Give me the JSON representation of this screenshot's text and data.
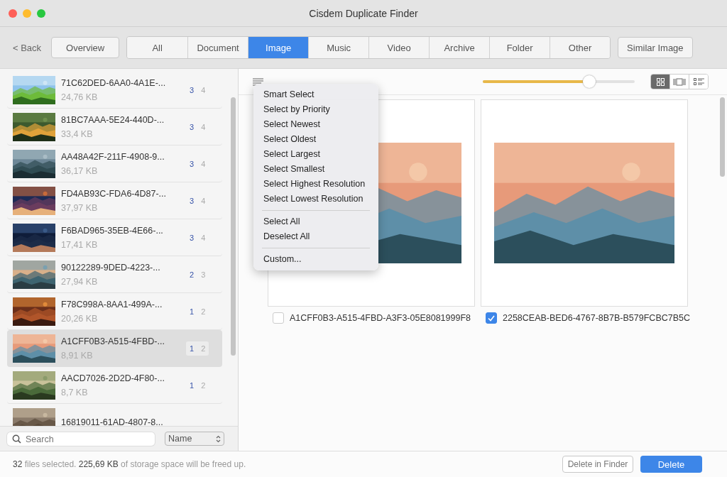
{
  "window": {
    "title": "Cisdem Duplicate Finder"
  },
  "toolbar": {
    "back": "< Back",
    "overview": "Overview",
    "similar": "Similar Image",
    "tabs": [
      {
        "label": "All",
        "selected": false
      },
      {
        "label": "Document",
        "selected": false
      },
      {
        "label": "Image",
        "selected": true
      },
      {
        "label": "Music",
        "selected": false
      },
      {
        "label": "Video",
        "selected": false
      },
      {
        "label": "Archive",
        "selected": false
      },
      {
        "label": "Folder",
        "selected": false
      },
      {
        "label": "Other",
        "selected": false
      }
    ]
  },
  "sidebar": {
    "items": [
      {
        "name": "71C62DED-6AA0-4A1E-...",
        "size": "24,76 KB",
        "selected_count": "3",
        "total_count": "4",
        "selected": false
      },
      {
        "name": "81BC7AAA-5E24-440D-...",
        "size": "33,4 KB",
        "selected_count": "3",
        "total_count": "4",
        "selected": false
      },
      {
        "name": "AA48A42F-211F-4908-9...",
        "size": "36,17 KB",
        "selected_count": "3",
        "total_count": "4",
        "selected": false
      },
      {
        "name": "FD4AB93C-FDA6-4D87-...",
        "size": "37,97 KB",
        "selected_count": "3",
        "total_count": "4",
        "selected": false
      },
      {
        "name": "F6BAD965-35EB-4E66-...",
        "size": "17,41 KB",
        "selected_count": "3",
        "total_count": "4",
        "selected": false
      },
      {
        "name": "90122289-9DED-4223-...",
        "size": "27,94 KB",
        "selected_count": "2",
        "total_count": "3",
        "selected": false
      },
      {
        "name": "F78C998A-8AA1-499A-...",
        "size": "20,26 KB",
        "selected_count": "1",
        "total_count": "2",
        "selected": false
      },
      {
        "name": "A1CFF0B3-A515-4FBD-...",
        "size": "8,91 KB",
        "selected_count": "1",
        "total_count": "2",
        "selected": true
      },
      {
        "name": "AACD7026-2D2D-4F80-...",
        "size": "8,7 KB",
        "selected_count": "1",
        "total_count": "2",
        "selected": false
      },
      {
        "name": "16819011-61AD-4807-8...",
        "selected": false
      }
    ],
    "search": {
      "placeholder": "Search"
    },
    "sort": "Name"
  },
  "preview": {
    "zoom": {
      "level": 0.7
    },
    "view_modes": [
      {
        "kind": "grid",
        "selected": true
      },
      {
        "kind": "filmstrip",
        "selected": false
      },
      {
        "kind": "list",
        "selected": false
      }
    ],
    "files": [
      {
        "name": "A1CFF0B3-A515-4FBD-A3F3-05E8081999F8",
        "checked": false
      },
      {
        "name": "2258CEAB-BED6-4767-8B7B-B579FCBC7B5C",
        "checked": true
      }
    ]
  },
  "menu": {
    "groups": [
      [
        "Smart Select",
        "Select by Priority",
        "Select Newest",
        "Select Oldest",
        "Select Largest",
        "Select Smallest",
        "Select Highest Resolution",
        "Select Lowest Resolution"
      ],
      [
        "Select All",
        "Deselect All"
      ],
      [
        "Custom..."
      ]
    ]
  },
  "status_bar": {
    "text": "**32** files selected. **225,69 KB** of storage space will be freed up.",
    "delete_in_finder": "Delete in Finder",
    "delete": "Delete"
  }
}
